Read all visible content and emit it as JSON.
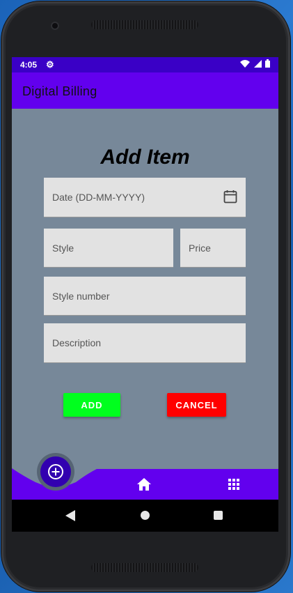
{
  "status_bar": {
    "time": "4:05"
  },
  "app_bar": {
    "title": "Digital Billing"
  },
  "form": {
    "title": "Add Item",
    "date_placeholder": "Date (DD-MM-YYYY)",
    "style_placeholder": "Style",
    "price_placeholder": "Price",
    "style_number_placeholder": "Style number",
    "description_placeholder": "Description"
  },
  "buttons": {
    "add_label": "ADD",
    "cancel_label": "CANCEL"
  },
  "icons": {
    "settings": "gear-icon",
    "calendar": "calendar-icon",
    "fab": "plus-circle-icon",
    "home": "home-icon",
    "grid": "grid-icon",
    "back": "back-triangle-icon",
    "sys_home": "home-circle-icon",
    "recents": "recents-square-icon"
  },
  "colors": {
    "status_bar": "#3a00c6",
    "app_bar": "#6200ee",
    "background": "#778899",
    "field": "#e2e2e2",
    "add_button": "#00ff1e",
    "cancel_button": "#ff0000",
    "fab": "#3200b0"
  }
}
